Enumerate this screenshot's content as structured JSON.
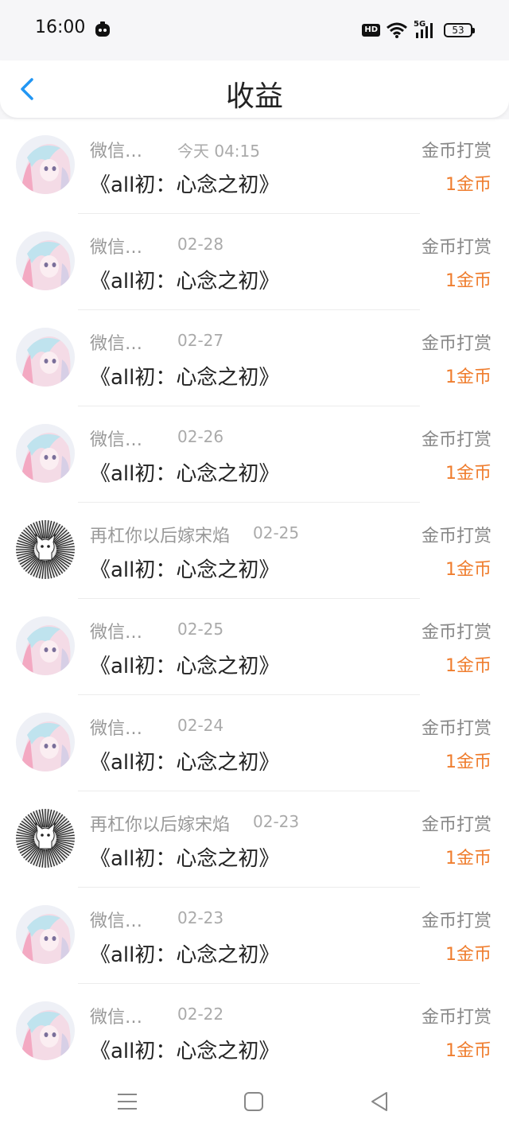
{
  "status": {
    "time": "16:00",
    "hd": "HD",
    "network": "5G",
    "battery": "53"
  },
  "header": {
    "title": "收益"
  },
  "rows": [
    {
      "name": "微信…",
      "date": "今天 04:15",
      "title": "《all初：心念之初》",
      "type": "金币打赏",
      "amount": "1金币",
      "avatar": "anime"
    },
    {
      "name": "微信…",
      "date": "02-28",
      "title": "《all初：心念之初》",
      "type": "金币打赏",
      "amount": "1金币",
      "avatar": "anime"
    },
    {
      "name": "微信…",
      "date": "02-27",
      "title": "《all初：心念之初》",
      "type": "金币打赏",
      "amount": "1金币",
      "avatar": "anime"
    },
    {
      "name": "微信…",
      "date": "02-26",
      "title": "《all初：心念之初》",
      "type": "金币打赏",
      "amount": "1金币",
      "avatar": "anime"
    },
    {
      "name": "再杠你以后嫁宋焰",
      "date": "02-25",
      "title": "《all初：心念之初》",
      "type": "金币打赏",
      "amount": "1金币",
      "avatar": "cat"
    },
    {
      "name": "微信…",
      "date": "02-25",
      "title": "《all初：心念之初》",
      "type": "金币打赏",
      "amount": "1金币",
      "avatar": "anime"
    },
    {
      "name": "微信…",
      "date": "02-24",
      "title": "《all初：心念之初》",
      "type": "金币打赏",
      "amount": "1金币",
      "avatar": "anime"
    },
    {
      "name": "再杠你以后嫁宋焰",
      "date": "02-23",
      "title": "《all初：心念之初》",
      "type": "金币打赏",
      "amount": "1金币",
      "avatar": "cat"
    },
    {
      "name": "微信…",
      "date": "02-23",
      "title": "《all初：心念之初》",
      "type": "金币打赏",
      "amount": "1金币",
      "avatar": "anime"
    },
    {
      "name": "微信…",
      "date": "02-22",
      "title": "《all初：心念之初》",
      "type": "金币打赏",
      "amount": "1金币",
      "avatar": "anime"
    }
  ],
  "colors": {
    "accent": "#2196f3",
    "amount": "#ef7d2e"
  },
  "icons": {
    "back": "back-arrow-icon",
    "menu": "menu-icon",
    "home": "home-icon",
    "back_nav": "back-triangle-icon"
  }
}
